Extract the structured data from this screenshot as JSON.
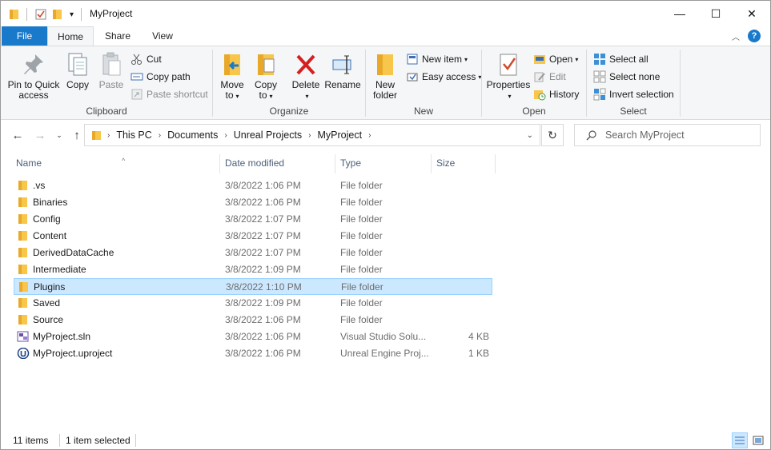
{
  "window": {
    "title": "MyProject",
    "minimize_glyph": "—",
    "maximize_glyph": "☐",
    "close_glyph": "✕"
  },
  "ribbon_tabs": [
    {
      "label": "File"
    },
    {
      "label": "Home"
    },
    {
      "label": "Share"
    },
    {
      "label": "View"
    }
  ],
  "help_glyph": "?",
  "ribbon": {
    "clipboard": {
      "label": "Clipboard",
      "pin_line1": "Pin to Quick",
      "pin_line2": "access",
      "copy": "Copy",
      "paste": "Paste",
      "cut": "Cut",
      "copy_path": "Copy path",
      "paste_shortcut": "Paste shortcut"
    },
    "organize": {
      "label": "Organize",
      "move_to_1": "Move",
      "move_to_2": "to",
      "copy_to_1": "Copy",
      "copy_to_2": "to",
      "delete": "Delete",
      "rename": "Rename"
    },
    "new": {
      "label": "New",
      "new_folder_1": "New",
      "new_folder_2": "folder",
      "new_item": "New item",
      "easy_access": "Easy access"
    },
    "open": {
      "label": "Open",
      "properties": "Properties",
      "open": "Open",
      "edit": "Edit",
      "history": "History"
    },
    "select": {
      "label": "Select",
      "select_all": "Select all",
      "select_none": "Select none",
      "invert_selection": "Invert selection"
    }
  },
  "address": {
    "breadcrumbs": [
      "This PC",
      "Documents",
      "Unreal Projects",
      "MyProject"
    ],
    "search_placeholder": "Search MyProject"
  },
  "columns": {
    "name": "Name",
    "date": "Date modified",
    "type": "Type",
    "size": "Size"
  },
  "files": [
    {
      "name": ".vs",
      "date": "3/8/2022 1:06 PM",
      "type": "File folder",
      "size": "",
      "icon": "folder-icon"
    },
    {
      "name": "Binaries",
      "date": "3/8/2022 1:06 PM",
      "type": "File folder",
      "size": "",
      "icon": "folder-icon"
    },
    {
      "name": "Config",
      "date": "3/8/2022 1:07 PM",
      "type": "File folder",
      "size": "",
      "icon": "folder-icon"
    },
    {
      "name": "Content",
      "date": "3/8/2022 1:07 PM",
      "type": "File folder",
      "size": "",
      "icon": "folder-icon"
    },
    {
      "name": "DerivedDataCache",
      "date": "3/8/2022 1:07 PM",
      "type": "File folder",
      "size": "",
      "icon": "folder-icon"
    },
    {
      "name": "Intermediate",
      "date": "3/8/2022 1:09 PM",
      "type": "File folder",
      "size": "",
      "icon": "folder-icon"
    },
    {
      "name": "Plugins",
      "date": "3/8/2022 1:10 PM",
      "type": "File folder",
      "size": "",
      "icon": "folder-icon",
      "selected": true
    },
    {
      "name": "Saved",
      "date": "3/8/2022 1:09 PM",
      "type": "File folder",
      "size": "",
      "icon": "folder-icon"
    },
    {
      "name": "Source",
      "date": "3/8/2022 1:06 PM",
      "type": "File folder",
      "size": "",
      "icon": "folder-icon"
    },
    {
      "name": "MyProject.sln",
      "date": "3/8/2022 1:06 PM",
      "type": "Visual Studio Solu...",
      "size": "4 KB",
      "icon": "visual-studio-icon"
    },
    {
      "name": "MyProject.uproject",
      "date": "3/8/2022 1:06 PM",
      "type": "Unreal Engine Proj...",
      "size": "1 KB",
      "icon": "unreal-engine-icon"
    }
  ],
  "status": {
    "item_count": "11 items",
    "selected": "1 item selected"
  },
  "colors": {
    "accent": "#1979ca",
    "selection": "#cce8ff",
    "selection_border": "#99d1ff",
    "folder": "#f7c64b"
  }
}
